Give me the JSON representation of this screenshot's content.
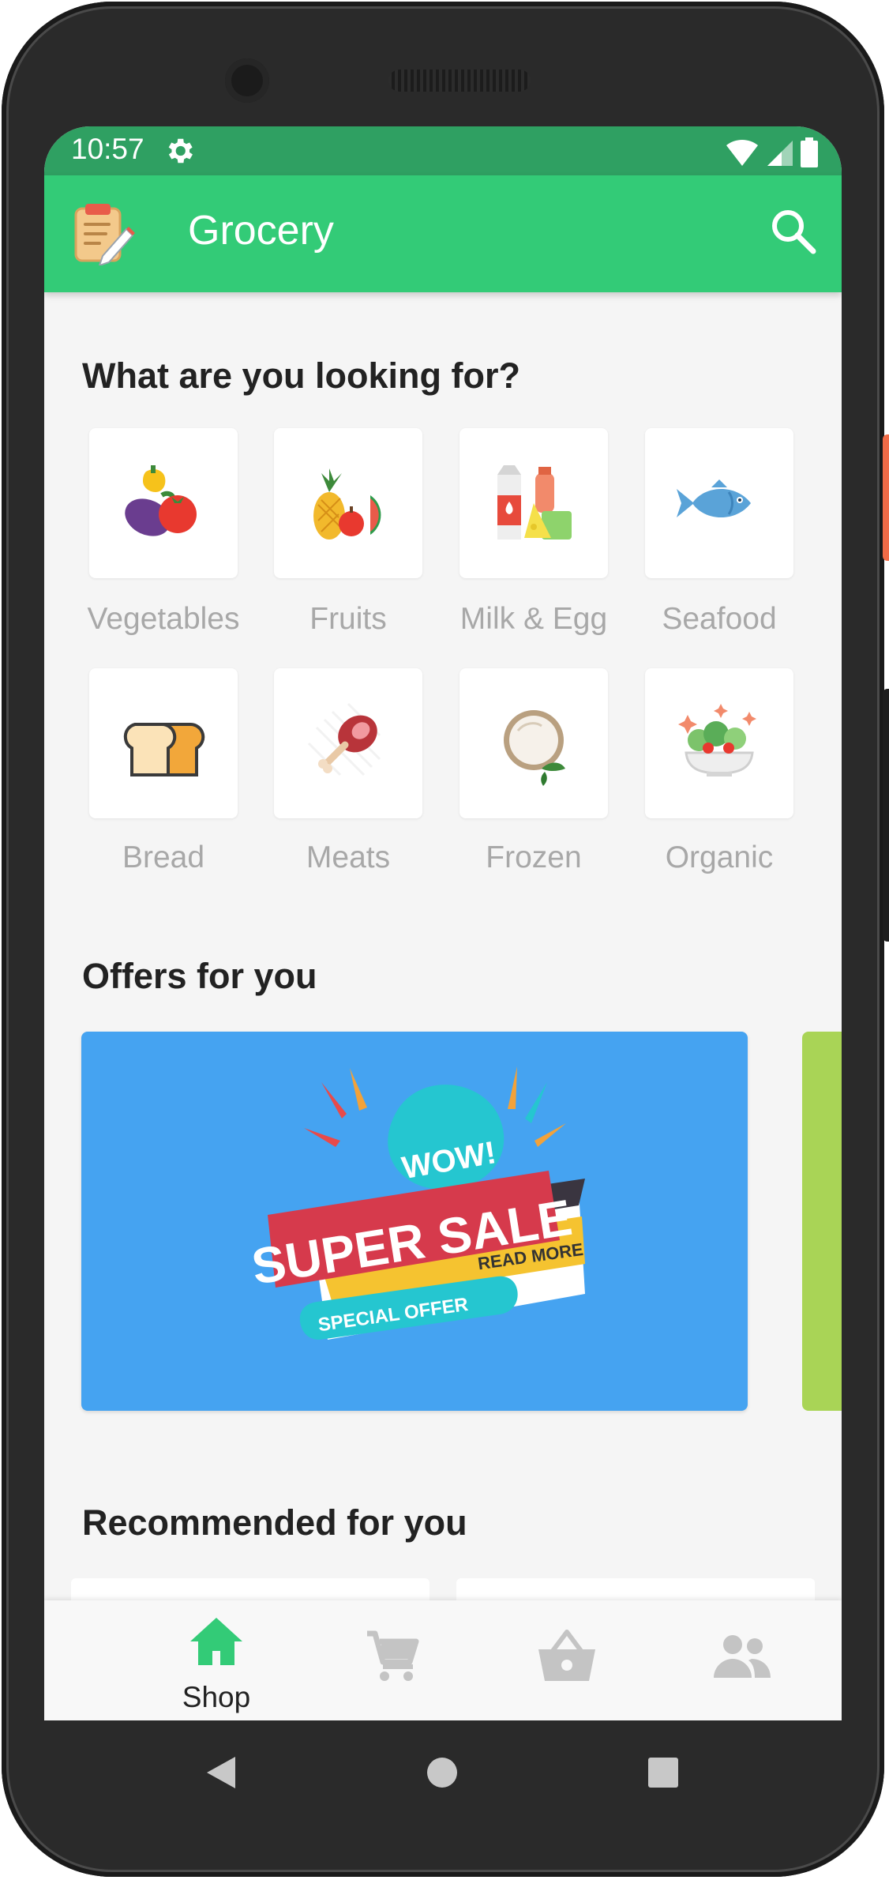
{
  "status_bar": {
    "time": "10:57"
  },
  "app_bar": {
    "title": "Grocery"
  },
  "categories_section": {
    "title": "What are you looking for?",
    "items": [
      {
        "label": "Vegetables",
        "icon": "vegetables-icon"
      },
      {
        "label": "Fruits",
        "icon": "fruits-icon"
      },
      {
        "label": "Milk & Egg",
        "icon": "milk-egg-icon"
      },
      {
        "label": "Seafood",
        "icon": "seafood-icon"
      },
      {
        "label": "Bread",
        "icon": "bread-icon"
      },
      {
        "label": "Meats",
        "icon": "meats-icon"
      },
      {
        "label": "Frozen",
        "icon": "frozen-icon"
      },
      {
        "label": "Organic",
        "icon": "organic-icon"
      }
    ]
  },
  "offers_section": {
    "title": "Offers for you",
    "banner": {
      "wow": "WOW!",
      "headline": "SUPER SALE",
      "read_more": "READ MORE",
      "special": "SPECIAL OFFER"
    }
  },
  "recommended_section": {
    "title": "Recommended for you"
  },
  "bottom_nav": {
    "items": [
      {
        "label": "Shop",
        "icon": "home-icon",
        "active": true
      },
      {
        "label": "",
        "icon": "cart-icon",
        "active": false
      },
      {
        "label": "",
        "icon": "basket-icon",
        "active": false
      },
      {
        "label": "",
        "icon": "people-icon",
        "active": false
      }
    ]
  },
  "colors": {
    "app_bar": "#33cb77",
    "status_bar": "#2fa062",
    "accent": "#33cb77",
    "offer_banner": "#45a3f1",
    "inactive_icon": "#c4c4c4"
  }
}
